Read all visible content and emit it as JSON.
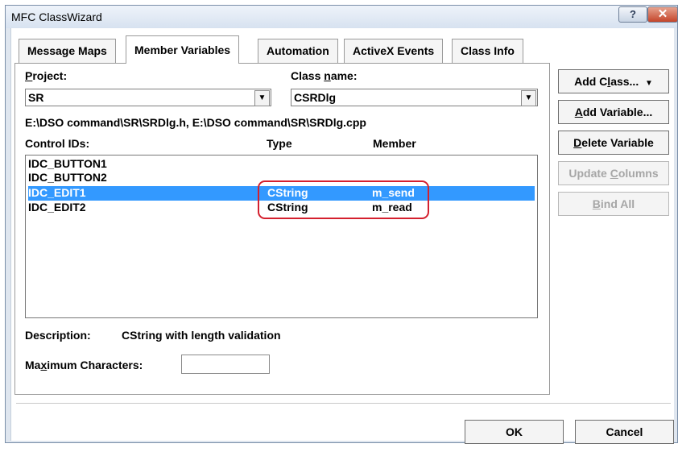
{
  "window": {
    "title": "MFC ClassWizard",
    "help_glyph": "?",
    "close_glyph": "✕"
  },
  "tabs": [
    {
      "label": "Message Maps",
      "active": false
    },
    {
      "label": "Member Variables",
      "active": true
    },
    {
      "label": "Automation",
      "active": false
    },
    {
      "label": "ActiveX Events",
      "active": false
    },
    {
      "label": "Class Info",
      "active": false
    }
  ],
  "project": {
    "label_u": "P",
    "label_rest": "roject:",
    "value": "SR"
  },
  "class_name": {
    "label_pre": "Class ",
    "label_u": "n",
    "label_rest": "ame:",
    "value": "CSRDlg"
  },
  "files": "E:\\DSO command\\SR\\SRDlg.h, E:\\DSO command\\SR\\SRDlg.cpp",
  "columns": {
    "control": "Control IDs:",
    "type": "Type",
    "member": "Member"
  },
  "rows": [
    {
      "id": "IDC_BUTTON1",
      "type": "",
      "member": "",
      "selected": false
    },
    {
      "id": "IDC_BUTTON2",
      "type": "",
      "member": "",
      "selected": false
    },
    {
      "id": "IDC_EDIT1",
      "type": "CString",
      "member": "m_send",
      "selected": true
    },
    {
      "id": "IDC_EDIT2",
      "type": "CString",
      "member": "m_read",
      "selected": false
    }
  ],
  "buttons": {
    "add_class_pre": "Add C",
    "add_class_u": "l",
    "add_class_rest": "ass...",
    "add_class_arrow": "▼",
    "add_variable_u": "A",
    "add_variable_rest": "dd Variable...",
    "delete_variable_u": "D",
    "delete_variable_rest": "elete Variable",
    "update_columns_pre": "Update ",
    "update_columns_u": "C",
    "update_columns_rest": "olumns",
    "bind_all_u": "B",
    "bind_all_rest": "ind All",
    "ok": "OK",
    "cancel": "Cancel"
  },
  "description": {
    "label": "Description:",
    "value": "CString with length validation"
  },
  "max_chars": {
    "label_pre": "Ma",
    "label_u": "x",
    "label_rest": "imum Characters:",
    "value": ""
  },
  "colors": {
    "selection": "#3399ff",
    "highlight_ring": "#d4202e"
  }
}
